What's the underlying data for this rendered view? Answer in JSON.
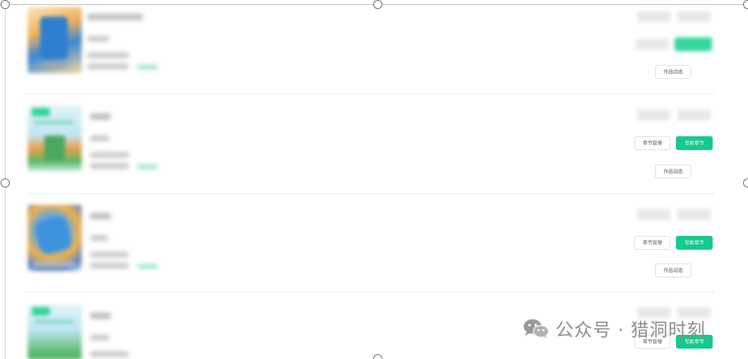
{
  "rows": [
    {
      "chapter_manage_label": "",
      "write_chapter_label": "",
      "dynamics_label": "作品动态"
    },
    {
      "chapter_manage_label": "章节管理",
      "write_chapter_label": "写新章节",
      "dynamics_label": "作品动态"
    },
    {
      "chapter_manage_label": "章节管理",
      "write_chapter_label": "写新章节",
      "dynamics_label": "作品动态"
    },
    {
      "chapter_manage_label": "章节管理",
      "write_chapter_label": "写新章节",
      "dynamics_label": ""
    }
  ],
  "watermark": {
    "text": "公众号 · 猎洞时刻",
    "icon": "wechat-icon"
  },
  "colors": {
    "accent": "#17c98a",
    "accent_soft": "#35d49a",
    "border": "#dcdcdc",
    "separator": "#ececec"
  }
}
